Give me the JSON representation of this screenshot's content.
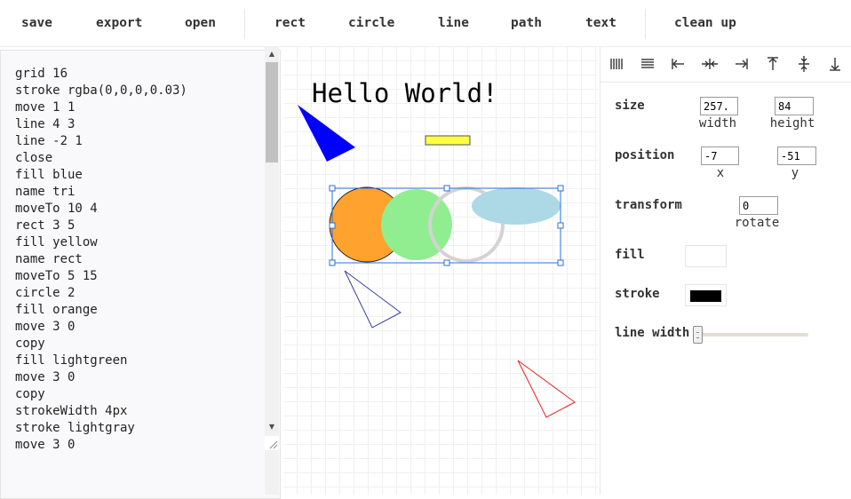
{
  "toolbar": {
    "save": "save",
    "export": "export",
    "open": "open",
    "rect": "rect",
    "circle": "circle",
    "line": "line",
    "path": "path",
    "text": "text",
    "clean_up": "clean up"
  },
  "editor": {
    "lines": [
      "grid 16",
      "stroke rgba(0,0,0,0.03)",
      "move 1 1",
      "line 4 3",
      "line -2 1",
      "close",
      "fill blue",
      "name tri",
      "moveTo 10 4",
      "rect 3 5",
      "fill yellow",
      "name rect",
      "moveTo 5 15",
      "circle 2",
      "fill orange",
      "move 3 0",
      "copy",
      "fill lightgreen",
      "move 3 0",
      "copy",
      "strokeWidth 4px",
      "stroke lightgray",
      "move 3 0"
    ]
  },
  "canvas": {
    "text": "Hello World!",
    "colors": {
      "triangle_fill": "#0000ff",
      "rect_fill": "#ffff44",
      "circle_orange": "#ffa22e",
      "circle_green": "#90ee90",
      "circle_stroke_gray": "#d3d3d3",
      "ellipse_blue": "#add8e6",
      "selection": "#2b6fdc",
      "triangle_outline_blue": "#3b3fa0",
      "triangle_outline_red": "#e82020"
    }
  },
  "align": {
    "icons": [
      "align-left-edges-icon",
      "align-center-lines-icon",
      "align-left-icon",
      "align-center-h-icon",
      "align-right-icon",
      "align-top-icon",
      "align-middle-v-icon",
      "align-bottom-icon"
    ]
  },
  "properties": {
    "size_label": "size",
    "width_value": "257.",
    "height_value": "84",
    "width_label": "width",
    "height_label": "height",
    "position_label": "position",
    "x_value": "-7",
    "y_value": "-51",
    "x_label": "x",
    "y_label": "y",
    "transform_label": "transform",
    "rotate_value": "0",
    "rotate_label": "rotate",
    "fill_label": "fill",
    "fill_color": "#ffffff",
    "stroke_label": "stroke",
    "stroke_color": "#000000",
    "line_width_label": "line width",
    "line_width_level": 0
  }
}
